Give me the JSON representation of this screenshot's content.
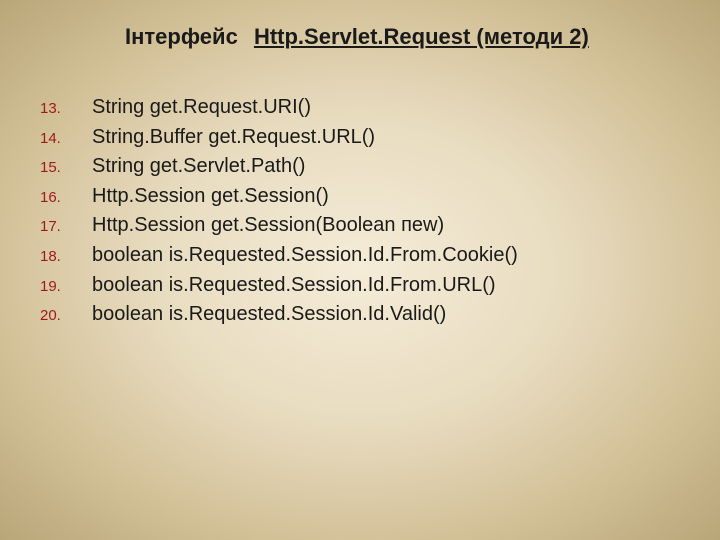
{
  "title": {
    "prefix": "Інтерфейс",
    "main": "Http.Servlet.Request (методи 2)"
  },
  "items": [
    {
      "num": "13.",
      "text": "String get.Request.URI()"
    },
    {
      "num": "14.",
      "text": "String.Buffer get.Request.URL()"
    },
    {
      "num": "15.",
      "text": "String get.Servlet.Path()"
    },
    {
      "num": "16.",
      "text": "Http.Session get.Session()"
    },
    {
      "num": "17.",
      "text": "Http.Session get.Session(Boolean пеw)"
    },
    {
      "num": "18.",
      "text": "boolean is.Requested.Session.Id.From.Cookie()"
    },
    {
      "num": "19.",
      "text": "boolean is.Requested.Session.Id.From.URL()"
    },
    {
      "num": "20.",
      "text": "boolean is.Requested.Session.Id.Valid()"
    }
  ]
}
